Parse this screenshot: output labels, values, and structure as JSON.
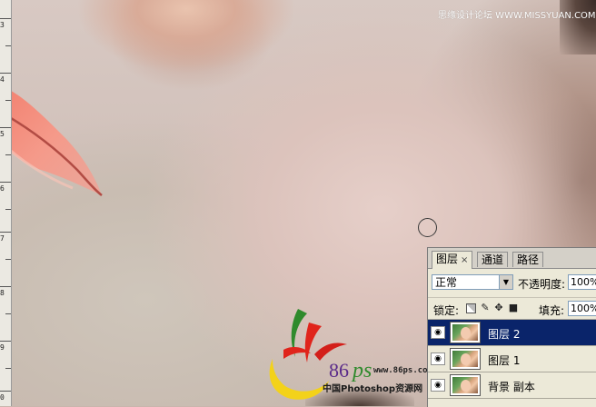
{
  "watermark": "思缘设计论坛 WWW.MISSYUAN.COM",
  "ruler": {
    "numbers": [
      "3",
      "4",
      "5",
      "6",
      "7",
      "8",
      "9",
      "0"
    ]
  },
  "logo": {
    "brand": "86",
    "brand_ps": "ps",
    "site": "www.86ps.com",
    "tagline": "中国Photoshop资源网"
  },
  "layers_panel": {
    "tabs": [
      {
        "label": "图层",
        "close": "×"
      },
      {
        "label": "通道"
      },
      {
        "label": "路径"
      }
    ],
    "blend_mode": "正常",
    "opacity_label": "不透明度:",
    "opacity_value": "100%",
    "lock_label": "锁定:",
    "fill_label": "填充:",
    "fill_value": "100%",
    "layers": [
      {
        "name": "图层 2",
        "selected": true
      },
      {
        "name": "图层 1",
        "selected": false
      },
      {
        "name": "背景 副本",
        "selected": false
      }
    ]
  },
  "icons": {
    "eye": "eye-icon",
    "lock_transparent": "lock-transparency-icon",
    "lock_paint": "lock-brush-icon",
    "lock_move": "lock-move-icon",
    "lock_all": "lock-all-icon",
    "dropdown": "chevron-down-icon",
    "cursor": "brush-cursor-icon"
  }
}
